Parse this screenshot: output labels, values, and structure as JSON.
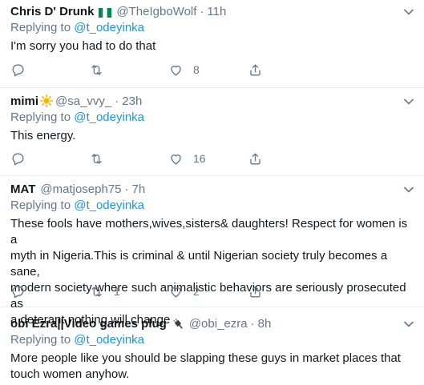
{
  "tweets": [
    {
      "name": "Chris D' Drunk",
      "handle": "@TheIgboWolf",
      "time": "11h",
      "replying_prefix": "Replying to",
      "replying_to": "@t_odeyinka",
      "text": "I'm sorry you had to do that",
      "replies": "",
      "retweets": "",
      "likes": "8"
    },
    {
      "name": "mimi",
      "handle": "@sa_vvy_",
      "time": "23h",
      "replying_prefix": "Replying to",
      "replying_to": "@t_odeyinka",
      "text": "This energy.",
      "replies": "",
      "retweets": "",
      "likes": "16"
    },
    {
      "name": "MAT",
      "handle": "@matjoseph75",
      "time": "7h",
      "replying_prefix": "Replying to",
      "replying_to": "@t_odeyinka",
      "text_lines": [
        "These fools have mothers,wives,sisters& daughters! Respect for women is a",
        "myth in Nigeria.This is criminal & until Nigerian society truly becomes a sane,",
        "modern society where such animalistic behaviors are seriously prosecuted as",
        "a deterant nothing will change"
      ],
      "replies": "",
      "retweets": "1",
      "likes": "2"
    },
    {
      "name": "obi Ezra||Video games plug",
      "handle": "@obi_ezra",
      "time": "8h",
      "replying_prefix": "Replying to",
      "replying_to": "@t_odeyinka",
      "text_lines": [
        "More people like you should be slapping these guys in market places that",
        "touch women anyhow."
      ]
    }
  ],
  "separator": "·",
  "colors": {
    "text": "#14171a",
    "secondary": "#657786",
    "link": "#1b95e0",
    "divider": "#e6ecf0",
    "flag_green": "#008751"
  },
  "icons": [
    "chevron-down-icon",
    "reply-icon",
    "retweet-icon",
    "like-icon",
    "share-icon",
    "nigeria-flag-icon",
    "sun-emoji-icon",
    "plug-emoji-icon"
  ]
}
